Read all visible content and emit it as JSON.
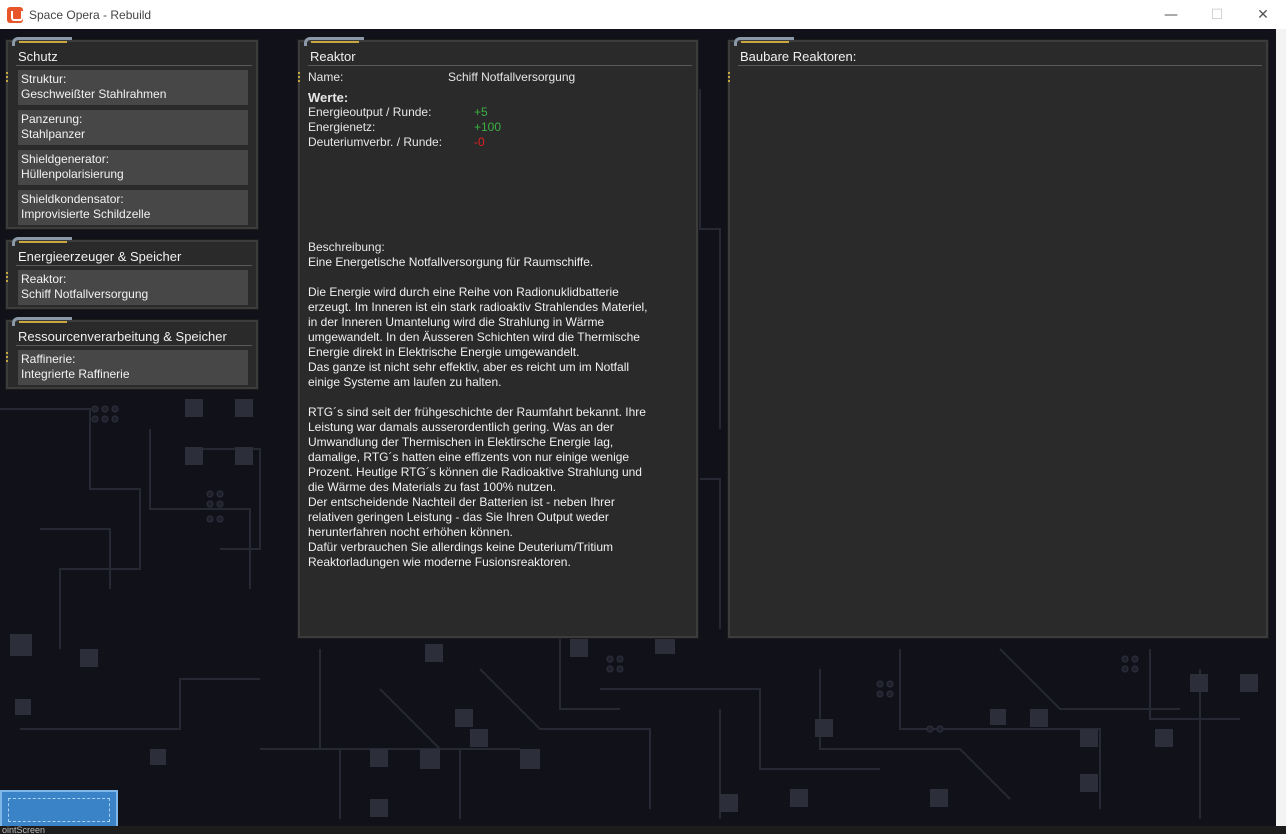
{
  "window": {
    "title": "Space Opera - Rebuild",
    "minimize": "—",
    "maximize": "☐",
    "close": "✕"
  },
  "schutz": {
    "title": "Schutz",
    "slots": [
      {
        "label": "Struktur:",
        "value": "Geschweißter Stahlrahmen"
      },
      {
        "label": "Panzerung:",
        "value": "Stahlpanzer"
      },
      {
        "label": "Shieldgenerator:",
        "value": "Hüllenpolarisierung"
      },
      {
        "label": "Shieldkondensator:",
        "value": "Improvisierte Schildzelle"
      }
    ]
  },
  "energie": {
    "title": "Energieerzeuger & Speicher",
    "slots": [
      {
        "label": "Reaktor:",
        "value": "Schiff Notfallversorgung"
      }
    ]
  },
  "ressourcen": {
    "title": "Ressourcenverarbeitung & Speicher",
    "slots": [
      {
        "label": "Raffinerie:",
        "value": "Integrierte Raffinerie"
      }
    ]
  },
  "reaktor": {
    "title": "Reaktor",
    "name_label": "Name:",
    "name_value": "Schiff Notfallversorgung",
    "werte_heading": "Werte:",
    "stats": [
      {
        "label": "Energieoutput / Runde:",
        "value": "+5",
        "color": "#3cb043"
      },
      {
        "label": "Energienetz:",
        "value": "+100",
        "color": "#3cb043"
      },
      {
        "label": "Deuteriumverbr. / Runde:",
        "value": "-0",
        "color": "#e02020"
      }
    ],
    "description_label": "Beschreibung:",
    "description": "Eine Energetische Notfallversorgung für Raumschiffe.\n\nDie Energie wird durch eine Reihe von Radionuklidbatterie\nerzeugt. Im Inneren ist ein stark radioaktiv Strahlendes Materiel,\nin der Inneren Umantelung wird die Strahlung in Wärme\numgewandelt. In den Äusseren Schichten wird die Thermische\nEnergie direkt in Elektrische Energie umgewandelt.\nDas ganze ist nicht sehr effektiv, aber es reicht um im Notfall\neinige Systeme am laufen zu halten.\n\nRTG´s sind seit der frühgeschichte der Raumfahrt bekannt. Ihre\nLeistung war damals ausserordentlich gering. Was an der\nUmwandlung der Thermischen in Elektirsche Energie lag,\ndamalige, RTG´s hatten eine effizents von nur einige wenige\nProzent. Heutige RTG´s können die Radioaktive Strahlung und\ndie Wärme des Materials zu fast 100% nutzen.\nDer entscheidende Nachteil der Batterien ist - neben Ihrer\nrelativen geringen Leistung - das Sie Ihren Output weder\nherunterfahren nocht erhöhen können.\nDafür verbrauchen Sie allerdings keine Deuterium/Tritium\nReaktorladungen wie moderne Fusionsreaktoren."
  },
  "baubare": {
    "title": "Baubare Reaktoren:"
  },
  "taskbar": {
    "text": "ointScreen"
  }
}
